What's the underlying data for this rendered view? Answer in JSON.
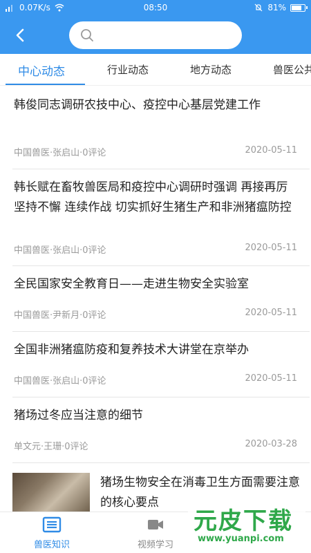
{
  "status_bar": {
    "speed": "0.07K/s",
    "time": "08:50",
    "battery_percent": "81%",
    "battery_level": 0.81
  },
  "header": {
    "search_placeholder": ""
  },
  "tabs": [
    {
      "label": "中心动态",
      "active": true
    },
    {
      "label": "行业动态",
      "active": false
    },
    {
      "label": "地方动态",
      "active": false
    },
    {
      "label": "兽医公共",
      "active": false
    }
  ],
  "news": [
    {
      "title": "韩俊同志调研农技中心、疫控中心基层党建工作",
      "meta": "中国兽医·张启山·0评论",
      "date": "2020-05-11"
    },
    {
      "title": "韩长赋在畜牧兽医局和疫控中心调研时强调 再接再厉 坚持不懈 连续作战 切实抓好生猪生产和非洲猪瘟防控",
      "meta": "中国兽医·张启山·0评论",
      "date": "2020-05-11"
    },
    {
      "title": "全民国家安全教育日——走进生物安全实验室",
      "meta": "中国兽医·尹新月·0评论",
      "date": "2020-05-11"
    },
    {
      "title": "全国非洲猪瘟防疫和复养技术大讲堂在京举办",
      "meta": "中国兽医·张启山·0评论",
      "date": "2020-05-11"
    },
    {
      "title": "猪场过冬应当注意的细节",
      "meta": "单文元·王珊·0评论",
      "date": "2020-03-28"
    },
    {
      "title": "猪场生物安全在消毒卫生方面需要注意的核心要点",
      "meta": "",
      "date": ""
    }
  ],
  "bottom_nav": [
    {
      "label": "兽医知识",
      "icon": "book-icon",
      "active": true
    },
    {
      "label": "视频学习",
      "icon": "video-icon",
      "active": false
    }
  ],
  "watermark": {
    "main": "元皮下载",
    "sub": "www.yuanpi.com"
  },
  "colors": {
    "header_blue": "#3a98f0",
    "accent_blue": "#2f8be6",
    "watermark_green": "#2fa84a"
  }
}
